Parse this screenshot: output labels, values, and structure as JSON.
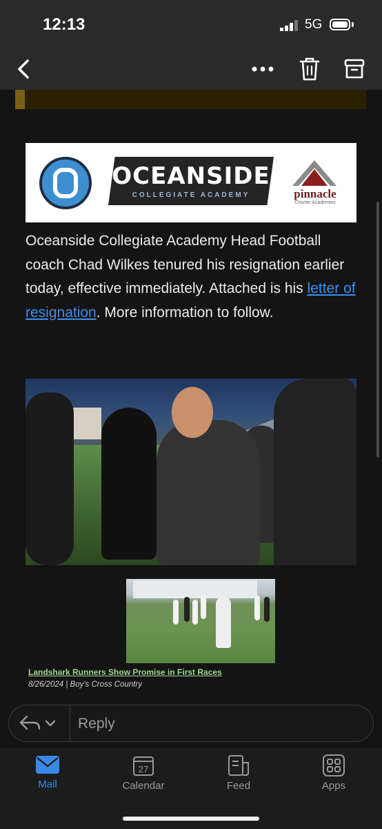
{
  "status_bar": {
    "time": "12:13",
    "network": "5G"
  },
  "toolbar": {
    "back_icon": "chevron-left-icon",
    "more_icon": "more-icon",
    "delete_icon": "trash-icon",
    "archive_icon": "archive-icon"
  },
  "banner": {
    "title": "OCEANSIDE",
    "subtitle": "COLLEGIATE ACADEMY",
    "partner_name": "pinnacle",
    "partner_sub": "Charter Academies"
  },
  "message": {
    "text_before_link": "Oceanside Collegiate Academy Head Football coach Chad Wilkes tenured his resignation earlier today, effective immediately. Attached is his ",
    "link_text": "letter of resignation",
    "text_after_link": ". More information to follow."
  },
  "news": {
    "headline": "Landshark Runners Show Promise in First Races",
    "meta": "8/26/2024 | Boy's Cross Country"
  },
  "reply": {
    "label": "Reply"
  },
  "tabs": [
    {
      "label": "Mail",
      "icon": "mail-icon",
      "active": true
    },
    {
      "label": "Calendar",
      "icon": "calendar-icon",
      "day": "27"
    },
    {
      "label": "Feed",
      "icon": "feed-icon"
    },
    {
      "label": "Apps",
      "icon": "apps-icon"
    }
  ],
  "colors": {
    "accent": "#3a88e8",
    "link": "#3c8ff0",
    "news_link": "#9ed690"
  }
}
